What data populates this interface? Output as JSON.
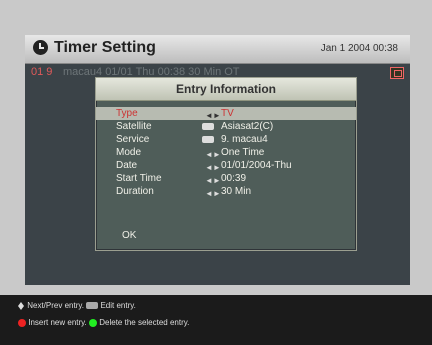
{
  "header": {
    "title": "Timer Setting",
    "datetime": "Jan 1 2004 00:38"
  },
  "timer_list": {
    "row_number": "01 9",
    "row_text_hidden": "macau4    01/01 Thu    00:38    30 Min    OT"
  },
  "dialog": {
    "title": "Entry Information",
    "fields": [
      {
        "label": "Type",
        "icon": "left-right-arrow-icon",
        "value": "TV"
      },
      {
        "label": "Satellite",
        "icon": "ok-icon",
        "value": "Asiasat2(C)"
      },
      {
        "label": "Service",
        "icon": "ok-icon",
        "value": "9. macau4"
      },
      {
        "label": "Mode",
        "icon": "left-right-arrow-icon",
        "value": "One Time"
      },
      {
        "label": "Date",
        "icon": "left-right-arrow-icon",
        "value": "01/01/2004-Thu"
      },
      {
        "label": "Start Time",
        "icon": "left-right-arrow-icon",
        "value": "00:39"
      },
      {
        "label": "Duration",
        "icon": "left-right-arrow-icon",
        "value": "30 Min"
      }
    ],
    "ok_label": "OK"
  },
  "footer": {
    "line1_a": "Next/Prev entry.",
    "line1_b": "Edit entry.",
    "line2_a": "Insert new entry.",
    "line2_b": "Delete the selected entry."
  },
  "colors": {
    "background": "#c9c9c9",
    "dialog": "#4f5d59",
    "highlight": "#b7bbb1",
    "selected_text": "#c33",
    "footer": "#1b1b1b"
  }
}
